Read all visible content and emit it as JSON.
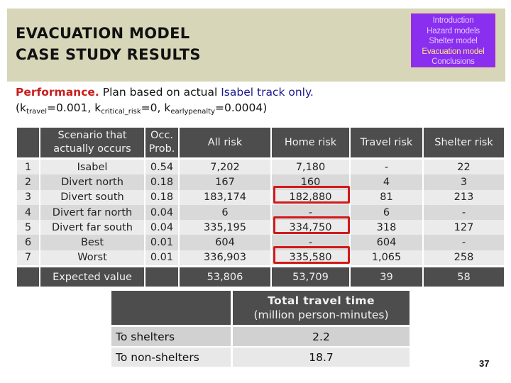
{
  "header": {
    "title_line1": "EVACUATION MODEL",
    "title_line2": "CASE STUDY RESULTS",
    "colors": {
      "banner": "#d8d6b8",
      "nav_bg": "#8a2ef0",
      "nav_active": "#ffe680",
      "nav_inactive": "#e0c8ff"
    }
  },
  "nav": {
    "items": [
      {
        "label": "Introduction",
        "active": false
      },
      {
        "label": "Hazard models",
        "active": false
      },
      {
        "label": "Shelter model",
        "active": false
      },
      {
        "label": "Evacuation model",
        "active": true
      },
      {
        "label": "Conclusions",
        "active": false
      }
    ]
  },
  "subtitle": {
    "lead": "Performance.",
    "text": " Plan based on actual ",
    "highlight": "Isabel track only.",
    "params_open": "(k",
    "k1_sub": "travel",
    "k1_val": "=0.001, k",
    "k2_sub": "critical_risk",
    "k2_val": "=0, k",
    "k3_sub": "earlypenalty",
    "k3_val": "=0.0004)"
  },
  "results_table": {
    "headers": [
      "",
      "Scenario that actually occurs",
      "Occ. Prob.",
      "All risk",
      "Home risk",
      "Travel risk",
      "Shelter risk"
    ],
    "header_scenario_l1": "Scenario that",
    "header_scenario_l2": "actually occurs",
    "header_occ_l1": "Occ.",
    "header_occ_l2": "Prob.",
    "rows": [
      [
        "1",
        "Isabel",
        "0.54",
        "7,202",
        "7,180",
        "-",
        "22"
      ],
      [
        "2",
        "Divert north",
        "0.18",
        "167",
        "160",
        "4",
        "3"
      ],
      [
        "3",
        "Divert south",
        "0.18",
        "183,174",
        "182,880",
        "81",
        "213"
      ],
      [
        "4",
        "Divert far north",
        "0.04",
        "6",
        "-",
        "6",
        "-"
      ],
      [
        "5",
        "Divert far south",
        "0.04",
        "335,195",
        "334,750",
        "318",
        "127"
      ],
      [
        "6",
        "Best",
        "0.01",
        "604",
        "-",
        "604",
        "-"
      ],
      [
        "7",
        "Worst",
        "0.01",
        "336,903",
        "335,580",
        "1,065",
        "258"
      ]
    ],
    "expected": {
      "label": "Expected value",
      "all_risk": "53,806",
      "home_risk": "53,709",
      "travel_risk": "39",
      "shelter_risk": "58"
    },
    "highlighted_home_risk_rows": [
      3,
      5,
      7
    ],
    "highlight_color": "#d11a1a"
  },
  "travel_table": {
    "header_l1": "Total travel time",
    "header_l2": "(million person-minutes)",
    "rows": [
      {
        "label": "To shelters",
        "value": "2.2"
      },
      {
        "label": "To non-shelters",
        "value": "18.7"
      }
    ]
  },
  "page_number": "37"
}
